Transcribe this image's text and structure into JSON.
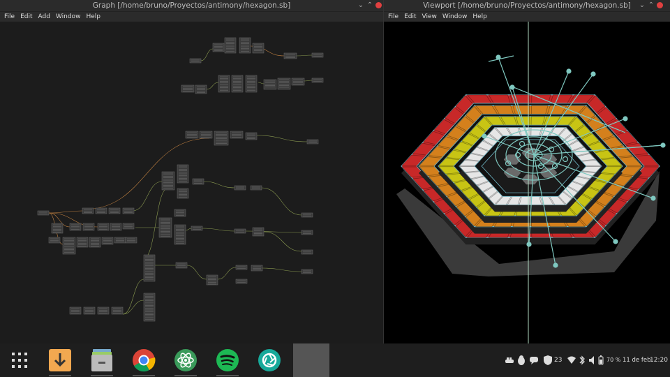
{
  "graph_window": {
    "title": "Graph [/home/bruno/Proyectos/antimony/hexagon.sb]",
    "menu": [
      "File",
      "Edit",
      "Add",
      "Window",
      "Help"
    ],
    "controls": [
      "⌄",
      "⌃"
    ]
  },
  "viewport_window": {
    "title": "Viewport [/home/bruno/Proyectos/antimony/hexagon.sb]",
    "menu": [
      "File",
      "Edit",
      "View",
      "Window",
      "Help"
    ],
    "controls": [
      "⌄",
      "⌃"
    ]
  },
  "taskbar": {
    "apps": [
      {
        "name": "app-launcher",
        "icon": "grid-icon"
      },
      {
        "name": "downloader",
        "icon": "download-icon"
      },
      {
        "name": "file-manager",
        "icon": "files-icon"
      },
      {
        "name": "chrome",
        "icon": "chrome-icon"
      },
      {
        "name": "atom",
        "icon": "atom-icon"
      },
      {
        "name": "spotify",
        "icon": "spotify-icon"
      },
      {
        "name": "shutter",
        "icon": "shutter-icon"
      },
      {
        "name": "antimony",
        "icon": "blank-app-icon"
      }
    ],
    "tray": {
      "notification_count": "23",
      "battery_percent": "70 %",
      "date": "11 de feb",
      "time": "12:20"
    }
  },
  "colors": {
    "hex_red": "#c82828",
    "hex_orange": "#d4801c",
    "hex_yellow": "#c8c414",
    "hex_white": "#e6e6e6",
    "handle_teal": "#7fc8c0",
    "wire_green": "#8a9a50",
    "wire_orange": "#c08040"
  }
}
